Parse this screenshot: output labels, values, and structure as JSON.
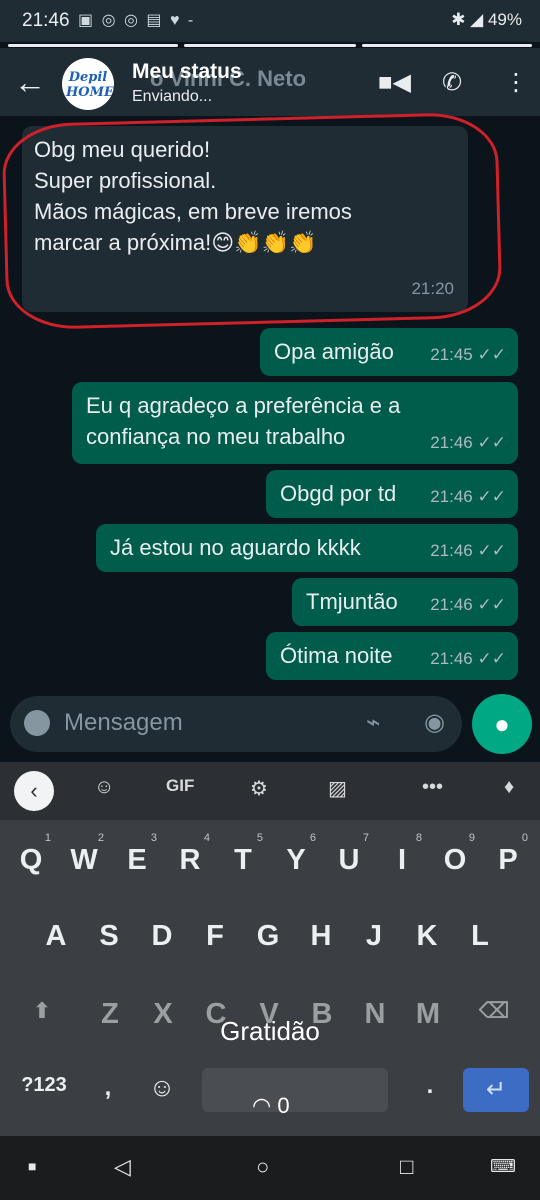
{
  "status_bar": {
    "time": "21:46",
    "left_icons": "▣ ◎ ◎ ▤ ♥ -",
    "right": "✱ ◢ 49%"
  },
  "header": {
    "ghost_name": "o Vinni C. Neto",
    "title": "Meu status",
    "subtitle": "Enviando...",
    "logo_text": "Depil HOME"
  },
  "messages": [
    {
      "dir": "in",
      "lines": [
        "Obg meu querido!",
        "Super profissional.",
        "Mãos mágicas, em breve iremos",
        "marcar a próxima!😊👏👏👏"
      ],
      "time": "21:20"
    },
    {
      "dir": "out",
      "lines": [
        "Opa amigão"
      ],
      "time": "21:45"
    },
    {
      "dir": "out",
      "lines": [
        "Eu q agradeço a preferência e a",
        "confiança no meu trabalho"
      ],
      "time": "21:46"
    },
    {
      "dir": "out",
      "lines": [
        "Obgd por td"
      ],
      "time": "21:46"
    },
    {
      "dir": "out",
      "lines": [
        "Já estou no aguardo kkkk"
      ],
      "time": "21:46"
    },
    {
      "dir": "out",
      "lines": [
        "Tmjuntão"
      ],
      "time": "21:46"
    },
    {
      "dir": "out",
      "lines": [
        "Ótima noite"
      ],
      "time": "21:46"
    }
  ],
  "input": {
    "placeholder": "Mensagem"
  },
  "keyboard": {
    "toolbar": {
      "gif": "GIF",
      "more": "•••"
    },
    "row1": [
      [
        "Q",
        "1"
      ],
      [
        "W",
        "2"
      ],
      [
        "E",
        "3"
      ],
      [
        "R",
        "4"
      ],
      [
        "T",
        "5"
      ],
      [
        "Y",
        "6"
      ],
      [
        "U",
        "7"
      ],
      [
        "I",
        "8"
      ],
      [
        "O",
        "9"
      ],
      [
        "P",
        "0"
      ]
    ],
    "row2": [
      "A",
      "S",
      "D",
      "F",
      "G",
      "H",
      "J",
      "K",
      "L"
    ],
    "row3": [
      "Z",
      "X",
      "C",
      "V",
      "B",
      "N",
      "M"
    ],
    "sym": "?123",
    "comma": ",",
    "period": "."
  },
  "overlay": {
    "caption": "Gratidão",
    "views": "0"
  },
  "colors": {
    "header": "#1f2c33",
    "outgoing": "#005c4b",
    "incoming": "#202c33",
    "accent": "#00a884",
    "highlight_ring": "#d0202a"
  }
}
